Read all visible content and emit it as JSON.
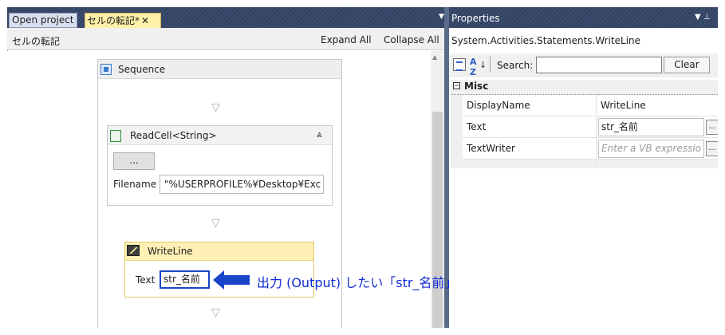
{
  "designer": {
    "tabs": [
      {
        "label": "Open project"
      },
      {
        "label": "セルの転記*",
        "close": "✕"
      }
    ],
    "breadcrumb": "セルの転記",
    "expand_all": "Expand All",
    "collapse_all": "Collapse All",
    "sequence": {
      "title": "Sequence"
    },
    "read_cell": {
      "title": "ReadCell<String>",
      "dots_label": "...",
      "filename_label": "Filename",
      "filename_value": "\"%USERPROFILE%¥Desktop¥Exc"
    },
    "write_line": {
      "title": "WriteLine",
      "text_label": "Text",
      "text_value": "str_名前"
    },
    "annotation": "出力 (Output) したい「str_名前」変数を入力",
    "annotation_color": "#0f2ad6"
  },
  "properties": {
    "title": "Properties",
    "pin_icon": "pin-icon",
    "type_name": "System.Activities.Statements.WriteLine",
    "search_label": "Search:",
    "search_value": "",
    "clear_label": "Clear",
    "category": {
      "label": "Misc",
      "toggle": "−"
    },
    "rows": [
      {
        "name": "DisplayName",
        "value": "WriteLine"
      },
      {
        "name": "Text",
        "value": "str_名前",
        "button": "..."
      },
      {
        "name": "TextWriter",
        "placeholder": "Enter a VB expressio",
        "button": "..."
      }
    ]
  },
  "colors": {
    "title_bar": "#3b4c72",
    "active_tab": "#fff1a8",
    "writeline_header": "#fff1b5",
    "highlight_border": "#1a44c9"
  }
}
